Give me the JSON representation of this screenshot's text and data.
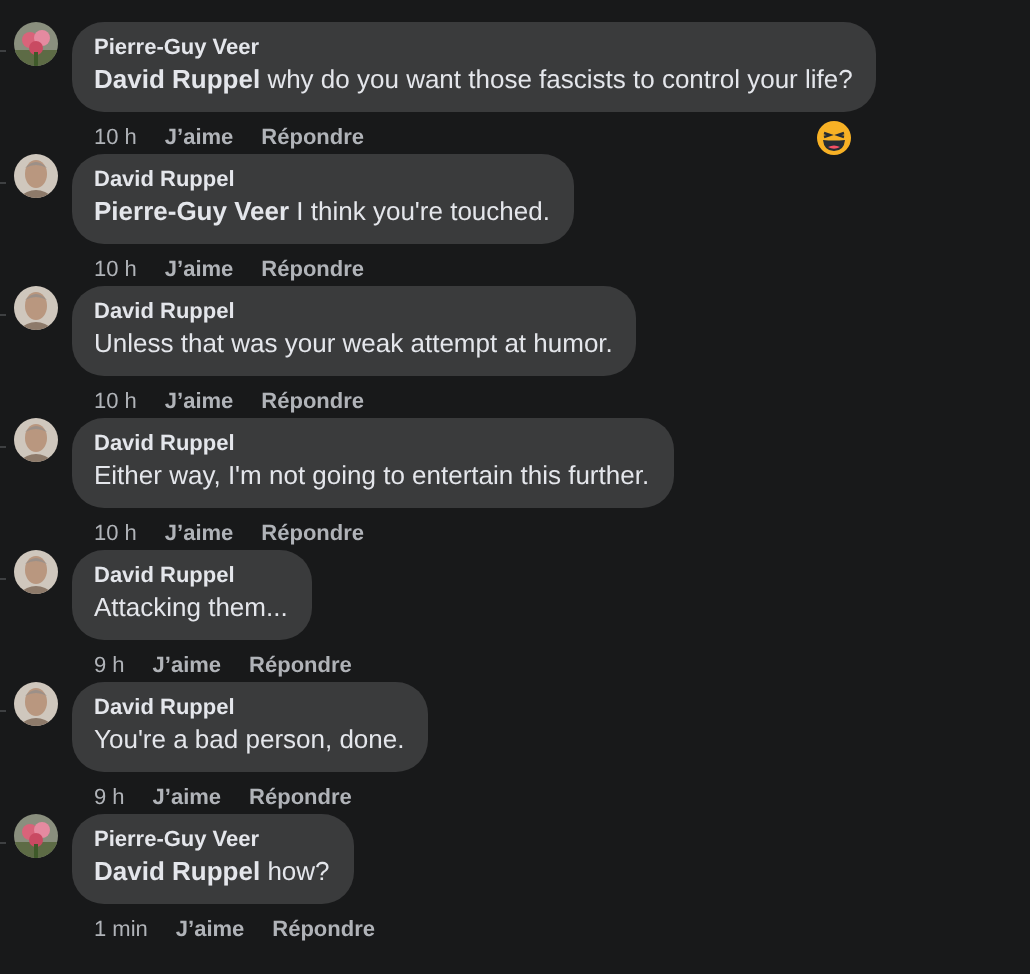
{
  "comments": [
    {
      "author": "Pierre-Guy Veer",
      "text": "**David Ruppel** why do you want those fascists to control your life?",
      "time": "10 h",
      "like": "J’aime",
      "reply": "Répondre",
      "avatar": {
        "kind": "flowers"
      },
      "reaction": {
        "kind": "haha"
      }
    },
    {
      "author": "David Ruppel",
      "text": "**Pierre-Guy Veer** I think you're touched.",
      "time": "10 h",
      "like": "J’aime",
      "reply": "Répondre",
      "avatar": {
        "kind": "person"
      }
    },
    {
      "author": "David Ruppel",
      "text": "Unless that was your weak attempt at humor.",
      "time": "10 h",
      "like": "J’aime",
      "reply": "Répondre",
      "avatar": {
        "kind": "person"
      }
    },
    {
      "author": "David Ruppel",
      "text": "Either way, I'm not going to entertain this further.",
      "time": "10 h",
      "like": "J’aime",
      "reply": "Répondre",
      "avatar": {
        "kind": "person"
      }
    },
    {
      "author": "David Ruppel",
      "text": "Attacking them...",
      "time": "9 h",
      "like": "J’aime",
      "reply": "Répondre",
      "avatar": {
        "kind": "person"
      }
    },
    {
      "author": "David Ruppel",
      "text": "You're a bad person, done.",
      "time": "9 h",
      "like": "J’aime",
      "reply": "Répondre",
      "avatar": {
        "kind": "person"
      }
    },
    {
      "author": "Pierre-Guy Veer",
      "text": "**David Ruppel** how?",
      "time": "1 min",
      "like": "J’aime",
      "reply": "Répondre",
      "avatar": {
        "kind": "flowers"
      }
    }
  ]
}
